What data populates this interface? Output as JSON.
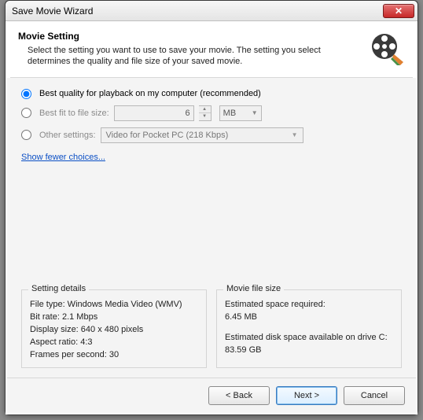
{
  "window": {
    "title": "Save Movie Wizard"
  },
  "header": {
    "title": "Movie Setting",
    "desc": "Select the setting you want to use to save your movie. The setting you select determines the quality and file size of your saved movie."
  },
  "options": {
    "best_quality": "Best quality for playback on my computer (recommended)",
    "best_fit": "Best fit to file size:",
    "fit_value": "6",
    "fit_unit": "MB",
    "other": "Other settings:",
    "other_value": "Video for Pocket PC (218 Kbps)",
    "link": "Show fewer choices..."
  },
  "details": {
    "title": "Setting details",
    "file_type": "File type: Windows Media Video (WMV)",
    "bit_rate": "Bit rate: 2.1 Mbps",
    "display_size": "Display size: 640 x 480 pixels",
    "aspect": "Aspect ratio: 4:3",
    "fps": "Frames per second: 30"
  },
  "filesize": {
    "title": "Movie file size",
    "req_label": "Estimated space required:",
    "req_value": "6.45 MB",
    "avail_label": "Estimated disk space available on drive C:",
    "avail_value": "83.59 GB"
  },
  "buttons": {
    "back": "< Back",
    "next": "Next >",
    "cancel": "Cancel"
  }
}
